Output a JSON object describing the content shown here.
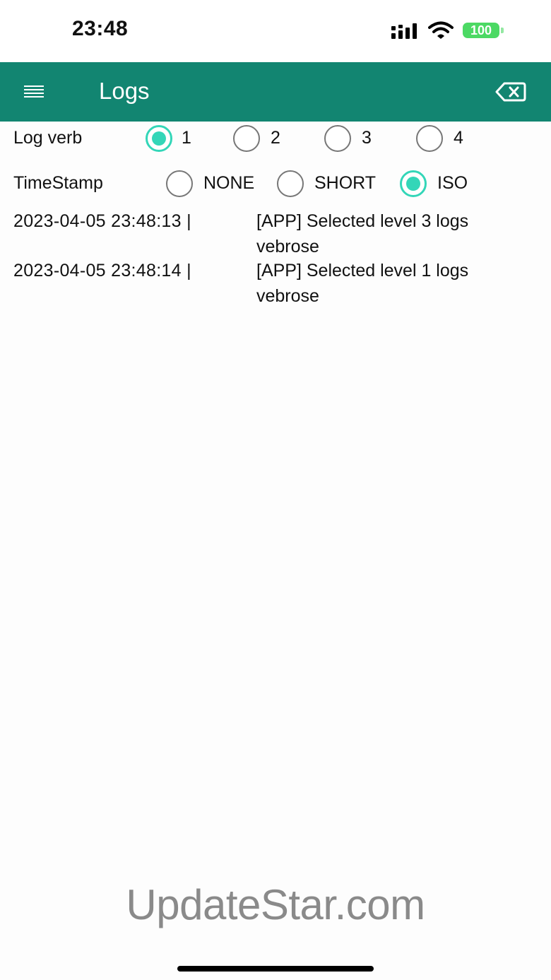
{
  "status_bar": {
    "time": "23:48",
    "battery": "100",
    "icons": [
      "signal-icon",
      "wifi-icon",
      "battery-icon"
    ]
  },
  "app_bar": {
    "title": "Logs",
    "menu_icon": "hamburger-menu-icon",
    "clear_icon": "backspace-clear-icon",
    "background": "#128571"
  },
  "log_verb": {
    "label": "Log verb",
    "options": [
      "1",
      "2",
      "3",
      "4"
    ],
    "selected": "1"
  },
  "timestamp": {
    "label": "TimeStamp",
    "options": [
      "NONE",
      "SHORT",
      "ISO"
    ],
    "selected": "ISO"
  },
  "logs": [
    {
      "timestamp": "2023-04-05 23:48:13 |",
      "message": "[APP] Selected level 3 logs vebrose"
    },
    {
      "timestamp": "2023-04-05 23:48:14 |",
      "message": "[APP] Selected level 1 logs vebrose"
    }
  ],
  "watermark": "UpdateStar.com",
  "accent_color": "#33d6b8"
}
